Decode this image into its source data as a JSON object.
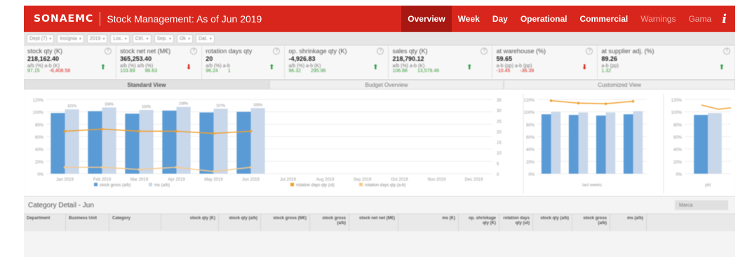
{
  "header": {
    "brand": "SONAEMC",
    "title": "Stock Management: As of Jun 2019",
    "tabs": [
      {
        "label": "Overview",
        "active": true,
        "dim": false
      },
      {
        "label": "Week",
        "active": false,
        "dim": false
      },
      {
        "label": "Day",
        "active": false,
        "dim": false
      },
      {
        "label": "Operational",
        "active": false,
        "dim": false
      },
      {
        "label": "Commercial",
        "active": false,
        "dim": false
      },
      {
        "label": "Warnings",
        "active": false,
        "dim": true
      },
      {
        "label": "Gama",
        "active": false,
        "dim": true
      }
    ],
    "info_icon": "info-icon",
    "accent": "#d9261c",
    "active_tab_color": "#a81812"
  },
  "filters": [
    "Dept (7)",
    "Insígnia",
    "2019",
    "Loc.",
    "Ctrl.",
    "Sep.",
    "Ok",
    "Dat."
  ],
  "kpis": [
    {
      "label": "stock qty (K)",
      "value": "218,162.40",
      "sub": "a/b (%)   a-b (K)",
      "subv": [
        "97.15",
        "-6,408.58"
      ],
      "arrow": "up"
    },
    {
      "label": "stock net net (M€)",
      "value": "365,253.40",
      "sub": "a/b (%)   a/b (%)",
      "subv": [
        "103.89",
        "96.63"
      ],
      "arrow": "down"
    },
    {
      "label": "rotation days qty",
      "value": "20",
      "sub": "a/b (%)   a-b",
      "subv": [
        "96.24",
        "1"
      ],
      "arrow": "up"
    },
    {
      "label": "op. shrinkage qty (K)",
      "value": "-4,926.83",
      "sub": "a/b (%)   a-b (K)",
      "subv": [
        "96.32",
        "295.96"
      ],
      "arrow": "up"
    },
    {
      "label": "sales qty (K)",
      "value": "218,790.12",
      "sub": "a/b (%)   a-b (K)",
      "subv": [
        "106.86",
        "13,579.46"
      ],
      "arrow": "up"
    },
    {
      "label": "at warehouse (%)",
      "value": "59.65",
      "sub": "a-b (pp)   a-b (pp)",
      "subv": [
        "-10.45",
        "-36.39"
      ],
      "arrow": "down"
    },
    {
      "label": "at supplier adj. (%)",
      "value": "89.26",
      "sub": "a-b (pp)",
      "subv": [
        "1.32"
      ],
      "arrow": "up"
    }
  ],
  "view_tabs": [
    "Standard View",
    "Budget Overview",
    "Customized View"
  ],
  "chart_data": [
    {
      "type": "bar",
      "categories": [
        "Jan 2019",
        "Feb 2019",
        "Mar 2019",
        "Apr 2019",
        "May 2019",
        "Jun 2019",
        "Jul 2019",
        "Aug 2019",
        "Sep 2019",
        "Oct 2019",
        "Nov 2019",
        "Dec 2019"
      ],
      "series": [
        {
          "name": "stock gross (a/b)",
          "values": [
            98,
            101,
            97,
            102,
            99,
            100,
            null,
            null,
            null,
            null,
            null,
            null
          ],
          "color": "#5b9bd5"
        },
        {
          "name": "ms (a/b)",
          "values": [
            104,
            107,
            103,
            108,
            105,
            106,
            null,
            null,
            null,
            null,
            null,
            null
          ],
          "color": "#c9d7ea"
        },
        {
          "name": "rotation days qty (ut)",
          "values": [
            20,
            21,
            20,
            20,
            19,
            20,
            null,
            null,
            null,
            null,
            null,
            null
          ],
          "color": "#f0a030"
        },
        {
          "name": "rotation days qty (a-b)",
          "values": [
            1,
            1,
            0,
            1,
            -1,
            1,
            null,
            null,
            null,
            null,
            null,
            null
          ],
          "color": "#f7c98a"
        }
      ],
      "ylim": [
        0,
        120
      ],
      "y_ticks": [
        "0%",
        "20%",
        "40%",
        "60%",
        "80%",
        "100%",
        "120%"
      ],
      "y2_ticks": [
        "0",
        "5",
        "10",
        "15",
        "20",
        "25",
        "30",
        "35"
      ],
      "data_labels": [
        "101%",
        "106%",
        "102%",
        "108%",
        "107%",
        "106%"
      ],
      "grid": true,
      "legend": "bottom"
    },
    {
      "type": "bar",
      "categories": [
        "",
        "",
        "",
        ""
      ],
      "xlabel": "last weeks",
      "series": [
        {
          "name": "",
          "values": [
            96,
            95,
            94,
            96
          ],
          "color": "#5b9bd5"
        },
        {
          "name": "",
          "values": [
            100,
            99,
            99,
            101
          ],
          "color": "#c9d7ea"
        },
        {
          "name": "",
          "values": [
            118,
            114,
            113,
            117
          ],
          "color": "#f0a030"
        }
      ],
      "ylim": [
        0,
        120
      ],
      "y_ticks": [
        "0%",
        "20%",
        "40%",
        "60%",
        "80%",
        "100%",
        "120%"
      ],
      "legend": "none"
    },
    {
      "type": "bar",
      "categories": [
        ""
      ],
      "xlabel": "ytd",
      "series": [
        {
          "name": "",
          "values": [
            95
          ],
          "color": "#5b9bd5"
        },
        {
          "name": "",
          "values": [
            98
          ],
          "color": "#c9d7ea"
        }
      ],
      "ylim": [
        0,
        120
      ],
      "y_ticks": [
        "0%",
        "20%",
        "40%",
        "60%",
        "80%",
        "100%",
        "120%"
      ],
      "legend": "none"
    }
  ],
  "category": {
    "title": "Category Detail - Jun",
    "button": "Marca",
    "columns": [
      {
        "label": "Department",
        "align": "left"
      },
      {
        "label": "Business Unit",
        "align": "left"
      },
      {
        "label": "Category",
        "align": "left"
      },
      {
        "label": "stock qty (K)",
        "align": "right"
      },
      {
        "label": "stock qty (a/b)",
        "align": "right"
      },
      {
        "label": "stock gross (M€)",
        "align": "right"
      },
      {
        "label": "stock gross (a/b)",
        "align": "right"
      },
      {
        "label": "stock net net (M€)",
        "align": "right"
      },
      {
        "label": "ms (K)",
        "align": "right"
      },
      {
        "label": "op. shrinkage qty (K)",
        "align": "right"
      },
      {
        "label": "rotation days qty (ut)",
        "align": "right"
      },
      {
        "label": "stock qty (a/b)",
        "align": "right"
      },
      {
        "label": "stock gross (a/b)",
        "align": "right"
      },
      {
        "label": "ms (a/b)",
        "align": "right"
      }
    ]
  }
}
